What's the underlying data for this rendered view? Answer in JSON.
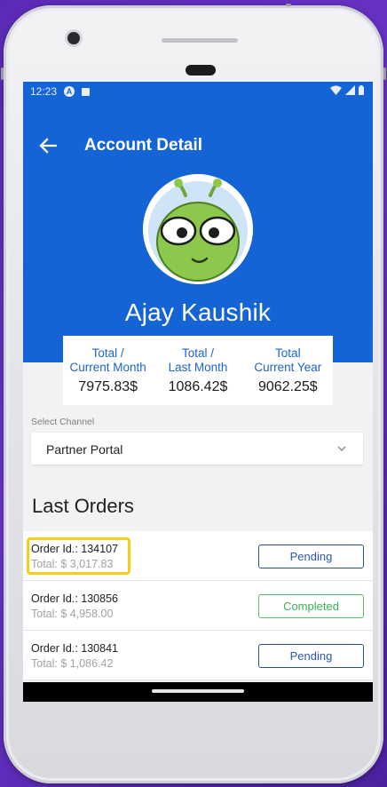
{
  "status_bar": {
    "time": "12:23",
    "icons": [
      "a-badge-icon",
      "sim-icon",
      "wifi-icon",
      "signal-icon",
      "battery-icon"
    ]
  },
  "header": {
    "back_icon": "arrow-left-icon",
    "title": "Account Detail"
  },
  "profile": {
    "avatar_icon": "green-alien-avatar",
    "name": "Ajay Kaushik"
  },
  "stats": [
    {
      "label_line1": "Total /",
      "label_line2": "Current Month",
      "value": "7975.83$"
    },
    {
      "label_line1": "Total /",
      "label_line2": "Last Month",
      "value": "1086.42$"
    },
    {
      "label_line1": "Total",
      "label_line2": "Current Year",
      "value": "9062.25$"
    }
  ],
  "channel": {
    "label": "Select Channel",
    "selected": "Partner Portal",
    "chevron_icon": "chevron-down-icon"
  },
  "orders_section": {
    "title": "Last Orders",
    "items": [
      {
        "id": "Order Id.: 134107",
        "total": "Total: $ 3,017.83",
        "status": "Pending",
        "highlighted": true
      },
      {
        "id": "Order Id.: 130856",
        "total": "Total: $ 4,958.00",
        "status": "Completed",
        "highlighted": false
      },
      {
        "id": "Order Id.: 130841",
        "total": "Total: $ 1,086.42",
        "status": "Pending",
        "highlighted": false
      }
    ]
  },
  "colors": {
    "primary": "#1564d6",
    "pending": "#2a56b0",
    "completed": "#3cae55",
    "highlight": "#f3cf1a"
  }
}
